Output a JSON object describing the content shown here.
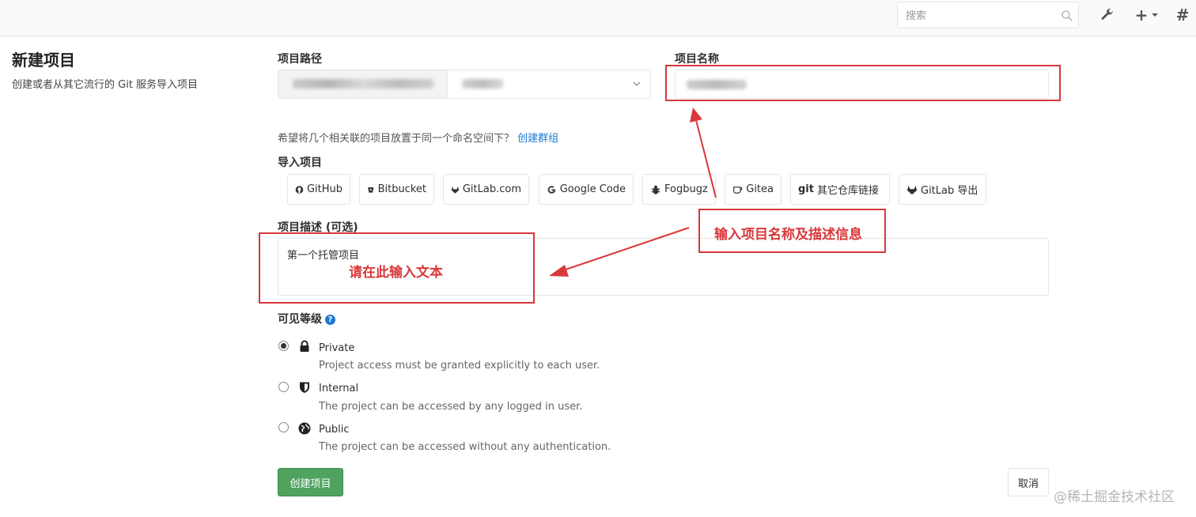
{
  "topbar": {
    "search_placeholder": "搜索",
    "icons": [
      "search-icon",
      "wrench-icon",
      "plus-icon",
      "chevron-down-icon",
      "hash-icon"
    ],
    "plus_label": "+",
    "hash_label": "#"
  },
  "page": {
    "title": "新建项目",
    "subtitle": "创建或者从其它流行的 Git 服务导入项目"
  },
  "form": {
    "path_label": "项目路径",
    "name_label": "项目名称",
    "group_hint": "希望将几个相关联的项目放置于同一个命名空间下？",
    "group_link": "创建群组",
    "import_label": "导入项目",
    "import_buttons": [
      {
        "label": "GitHub",
        "icon": "github-icon"
      },
      {
        "label": "Bitbucket",
        "icon": "bitbucket-icon"
      },
      {
        "label": "GitLab.com",
        "icon": "gitlab-icon"
      },
      {
        "label": "Google Code",
        "icon": "google-icon"
      },
      {
        "label": "Fogbugz",
        "icon": "bug-icon"
      },
      {
        "label": "Gitea",
        "icon": "gitea-icon"
      },
      {
        "label": "其它仓库链接",
        "icon": "git-icon",
        "prefix": "git"
      },
      {
        "label": "GitLab 导出",
        "icon": "gitlab-icon"
      }
    ],
    "desc_label": "项目描述 (可选)",
    "desc_value": "第一个托管项目",
    "visibility_label": "可见等级",
    "visibility_help": "?",
    "visibility": [
      {
        "title": "Private",
        "desc": "Project access must be granted explicitly to each user.",
        "icon": "lock-icon",
        "checked": true
      },
      {
        "title": "Internal",
        "desc": "The project can be accessed by any logged in user.",
        "icon": "shield-icon",
        "checked": false
      },
      {
        "title": "Public",
        "desc": "The project can be accessed without any authentication.",
        "icon": "globe-icon",
        "checked": false
      }
    ],
    "create_label": "创建项目",
    "cancel_label": "取消"
  },
  "annotations": {
    "name_desc_note": "输入项目名称及描述信息",
    "desc_note": "请在此输入文本",
    "color": "#d9383a"
  },
  "watermark": "@稀土掘金技术社区",
  "colors": {
    "primary_green": "#4fa35f",
    "link_blue": "#1f78d1"
  }
}
